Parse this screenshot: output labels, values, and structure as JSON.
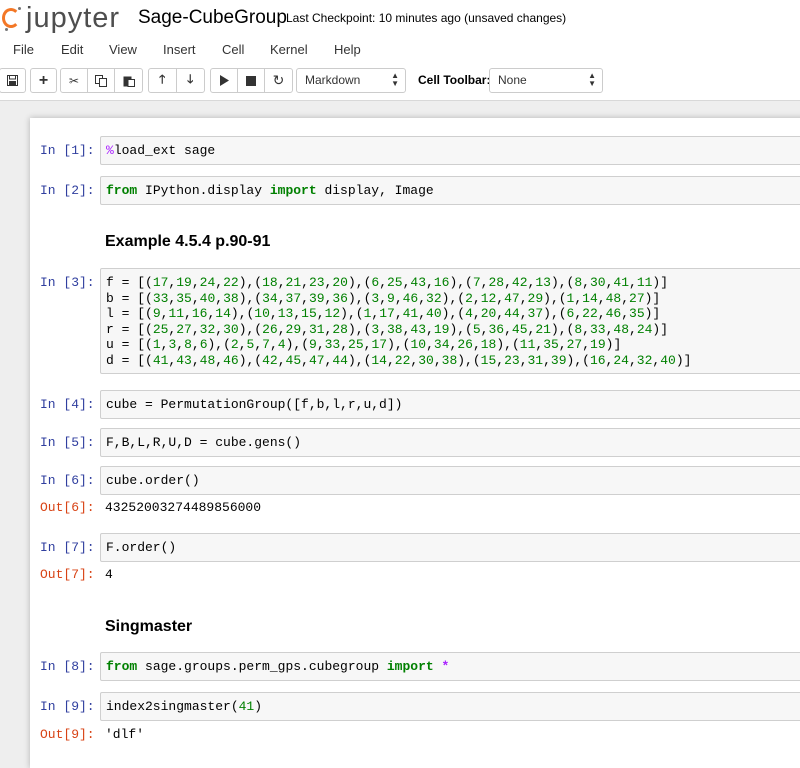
{
  "header": {
    "logo_text": "jupyter",
    "notebook_title": "Sage-CubeGroup",
    "checkpoint": "Last Checkpoint: 10 minutes ago (unsaved changes)"
  },
  "menu": [
    "File",
    "Edit",
    "View",
    "Insert",
    "Cell",
    "Kernel",
    "Help"
  ],
  "toolbar": {
    "cell_type": "Markdown",
    "cell_toolbar_label": "Cell Toolbar:",
    "cell_toolbar_value": "None"
  },
  "colors": {
    "accent": "#f37726",
    "in_prompt": "#303f9f",
    "out_prompt": "#d84315",
    "keyword": "#008000"
  },
  "cells": {
    "c1": {
      "prompt": "In [1]:"
    },
    "c2": {
      "prompt": "In [2]:"
    },
    "h1": {
      "text": "Example 4.5.4     p.90-91"
    },
    "c3": {
      "prompt": "In [3]:"
    },
    "c4": {
      "prompt": "In [4]:",
      "code": "cube = PermutationGroup([f,b,l,r,u,d])"
    },
    "c5": {
      "prompt": "In [5]:",
      "code": "F,B,L,R,U,D = cube.gens()"
    },
    "c6": {
      "prompt": "In [6]:",
      "code": "cube.order()",
      "out_prompt": "Out[6]:",
      "output": "43252003274489856000"
    },
    "c7": {
      "prompt": "In [7]:",
      "code": "F.order()",
      "out_prompt": "Out[7]:",
      "output": "4"
    },
    "h2": {
      "text": "Singmaster"
    },
    "c8": {
      "prompt": "In [8]:"
    },
    "c9": {
      "prompt": "In [9]:",
      "out_prompt": "Out[9]:",
      "output": "'dlf'"
    }
  }
}
